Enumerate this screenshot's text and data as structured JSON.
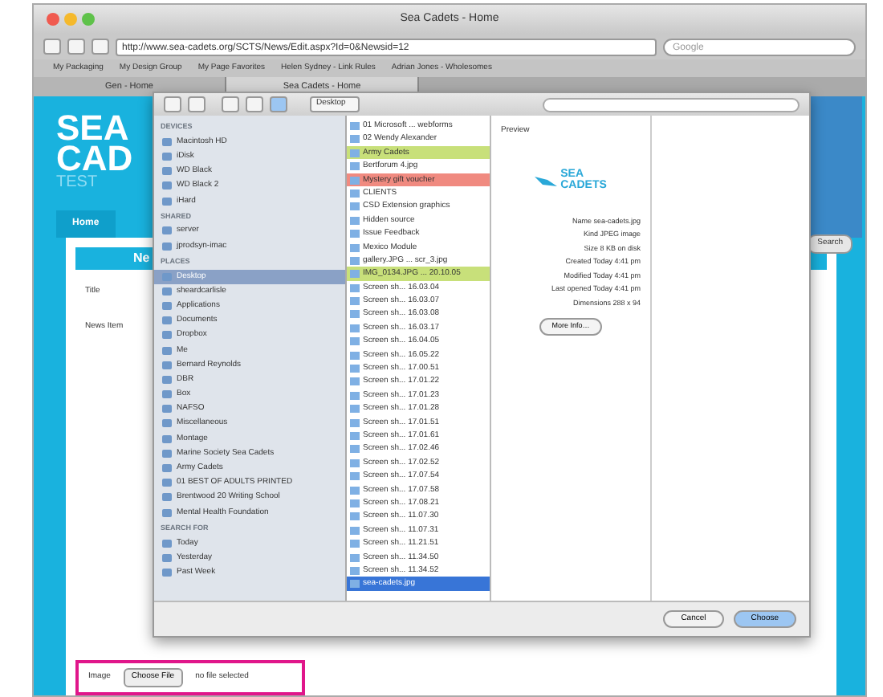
{
  "window": {
    "title": "Sea Cadets - Home"
  },
  "toolbar": {
    "url": "http://www.sea-cadets.org/SCTS/News/Edit.aspx?Id=0&Newsid=12",
    "search_placeholder": "Google"
  },
  "bookmarks": [
    "My Packaging",
    "My Design Group",
    "My Page Favorites",
    "Helen Sydney - Link Rules",
    "Adrian Jones - Wholesomes"
  ],
  "tabs": [
    {
      "label": "Gen - Home",
      "selected": false
    },
    {
      "label": "Sea Cadets - Home",
      "selected": true
    }
  ],
  "page": {
    "logo_lines": [
      "SEA",
      "CAD"
    ],
    "logo_sub": "TEST",
    "nav": [
      "Home"
    ],
    "bar_text": "Ne",
    "fields": [
      "Title",
      "News Item"
    ],
    "search_button": "Search",
    "image_label": "Image",
    "choose_button": "Choose File",
    "file_status": "no file selected"
  },
  "dialog": {
    "location": "Desktop",
    "sidebar": [
      {
        "heading": "DEVICES",
        "items": [
          {
            "label": "Macintosh HD",
            "selected": false
          },
          {
            "label": "iDisk",
            "selected": false
          },
          {
            "label": "WD Black",
            "selected": false
          },
          {
            "label": "WD Black 2",
            "selected": false
          },
          {
            "label": "iHard",
            "selected": false
          }
        ]
      },
      {
        "heading": "SHARED",
        "items": [
          {
            "label": "server",
            "selected": false
          },
          {
            "label": "jprodsyn-imac",
            "selected": false
          }
        ]
      },
      {
        "heading": "PLACES",
        "items": [
          {
            "label": "Desktop",
            "selected": true
          },
          {
            "label": "sheardcarlisle",
            "selected": false
          },
          {
            "label": "Applications",
            "selected": false
          },
          {
            "label": "Documents",
            "selected": false
          },
          {
            "label": "Dropbox",
            "selected": false
          },
          {
            "label": "Me",
            "selected": false
          },
          {
            "label": "Bernard Reynolds",
            "selected": false
          },
          {
            "label": "DBR",
            "selected": false
          },
          {
            "label": "Box",
            "selected": false
          },
          {
            "label": "NAFSO",
            "selected": false
          },
          {
            "label": "Miscellaneous",
            "selected": false
          },
          {
            "label": "Montage",
            "selected": false
          },
          {
            "label": "Marine Society Sea Cadets",
            "selected": false
          },
          {
            "label": "Army Cadets",
            "selected": false
          },
          {
            "label": "01 BEST OF ADULTS PRINTED",
            "selected": false
          },
          {
            "label": "Brentwood 20 Writing School",
            "selected": false
          },
          {
            "label": "Mental Health Foundation",
            "selected": false
          }
        ]
      },
      {
        "heading": "SEARCH FOR",
        "items": [
          {
            "label": "Today",
            "selected": false
          },
          {
            "label": "Yesterday",
            "selected": false
          },
          {
            "label": "Past Week",
            "selected": false
          }
        ]
      }
    ],
    "files": [
      {
        "name": "01 Microsoft ... webforms",
        "selected": false
      },
      {
        "name": "02 Wendy Alexander",
        "selected": false
      },
      {
        "name": "Army Cadets",
        "selected": false,
        "color": "#c8e07a"
      },
      {
        "name": "Bertforum 4.jpg",
        "selected": false
      },
      {
        "name": "Mystery gift voucher",
        "selected": false,
        "color": "#f08a80"
      },
      {
        "name": "CLIENTS",
        "selected": false
      },
      {
        "name": "CSD Extension graphics",
        "selected": false
      },
      {
        "name": "Hidden source",
        "selected": false
      },
      {
        "name": "Issue Feedback",
        "selected": false
      },
      {
        "name": "Mexico Module",
        "selected": false
      },
      {
        "name": "gallery.JPG ... scr_3.jpg",
        "selected": false
      },
      {
        "name": "IMG_0134.JPG ... 20.10.05",
        "selected": false,
        "color": "#c8e07a"
      },
      {
        "name": "Screen sh... 16.03.04",
        "selected": false
      },
      {
        "name": "Screen sh... 16.03.07",
        "selected": false
      },
      {
        "name": "Screen sh... 16.03.08",
        "selected": false
      },
      {
        "name": "Screen sh... 16.03.17",
        "selected": false
      },
      {
        "name": "Screen sh... 16.04.05",
        "selected": false
      },
      {
        "name": "Screen sh... 16.05.22",
        "selected": false
      },
      {
        "name": "Screen sh... 17.00.51",
        "selected": false
      },
      {
        "name": "Screen sh... 17.01.22",
        "selected": false
      },
      {
        "name": "Screen sh... 17.01.23",
        "selected": false
      },
      {
        "name": "Screen sh... 17.01.28",
        "selected": false
      },
      {
        "name": "Screen sh... 17.01.51",
        "selected": false
      },
      {
        "name": "Screen sh... 17.01.61",
        "selected": false
      },
      {
        "name": "Screen sh... 17.02.46",
        "selected": false
      },
      {
        "name": "Screen sh... 17.02.52",
        "selected": false
      },
      {
        "name": "Screen sh... 17.07.54",
        "selected": false
      },
      {
        "name": "Screen sh... 17.07.58",
        "selected": false
      },
      {
        "name": "Screen sh... 17.08.21",
        "selected": false
      },
      {
        "name": "Screen sh... 11.07.30",
        "selected": false
      },
      {
        "name": "Screen sh... 11.07.31",
        "selected": false
      },
      {
        "name": "Screen sh... 11.21.51",
        "selected": false
      },
      {
        "name": "Screen sh... 11.34.50",
        "selected": false
      },
      {
        "name": "Screen sh... 11.34.52",
        "selected": false
      },
      {
        "name": "sea-cadets.jpg",
        "selected": true
      }
    ],
    "preview_heading": "Preview",
    "preview_logo": [
      "SEA",
      "CADETS"
    ],
    "info": [
      "Name sea-cadets.jpg",
      "Kind JPEG image",
      "Size 8 KB on disk",
      "Created Today 4:41 pm",
      "Modified Today 4:41 pm",
      "Last opened Today 4:41 pm",
      "Dimensions 288 x 94"
    ],
    "more_info": "More Info…",
    "buttons": [
      "Cancel",
      "Choose"
    ]
  }
}
